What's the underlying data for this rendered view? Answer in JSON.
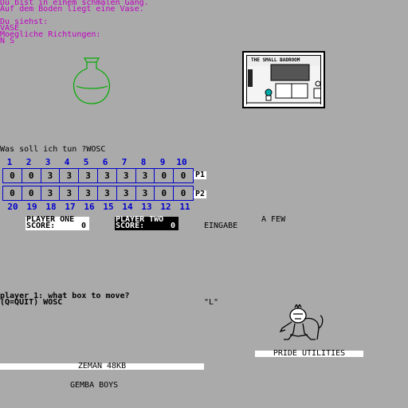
{
  "story": {
    "line1": "Du bist in einem schmalen Gang.",
    "line2": "Auf dem Boden liegt eine Vase.",
    "line3": "Du siehst:",
    "line4": "VASE",
    "line5": "Moegliche Richtungen:",
    "line6": "N S"
  },
  "prompt": {
    "question": "Was soll ich tun ?WOSC"
  },
  "room": {
    "title": "THE SMALL BADROOM"
  },
  "board": {
    "top_numbers": [
      "1",
      "2",
      "3",
      "4",
      "5",
      "6",
      "7",
      "8",
      "9",
      "10"
    ],
    "row1": [
      "0",
      "0",
      "3",
      "3",
      "3",
      "3",
      "3",
      "3",
      "0",
      "0"
    ],
    "row2": [
      "0",
      "0",
      "3",
      "3",
      "3",
      "3",
      "3",
      "3",
      "0",
      "0"
    ],
    "bottom_numbers": [
      "20",
      "19",
      "18",
      "17",
      "16",
      "15",
      "14",
      "13",
      "12",
      "11"
    ],
    "p1_tag": "P1",
    "p2_tag": "P2"
  },
  "players": {
    "one_name": "PLAYER ONE",
    "one_score_label": "SCORE:",
    "one_score": "0",
    "two_name": "PLAYER TWO",
    "two_score_label": "SCORE:",
    "two_score": "0"
  },
  "eingabe": "EINGABE",
  "a_few": "A FEW",
  "move_prompt": {
    "line1": "player 1: what box to move?",
    "line2": "(Q=QUIT) WOSC"
  },
  "quote_L": "\"L\"",
  "pride": "PRIDE UTILITIES",
  "zeman": "ZEMAN 48KB",
  "gemba": "GEMBA BOYS",
  "colors": {
    "background": "#aaaaaa",
    "magenta": "#c000c0",
    "blue": "#0000cc",
    "vase": "#00aa00"
  }
}
